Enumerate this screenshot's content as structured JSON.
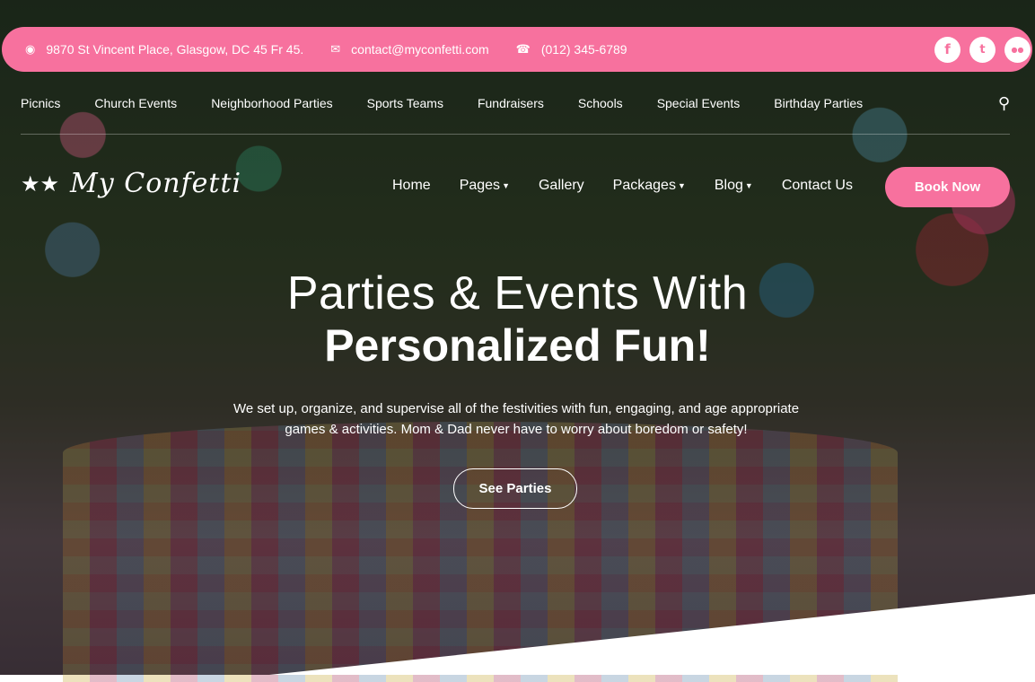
{
  "contact": {
    "address": "9870 St Vincent Place, Glasgow, DC 45 Fr 45.",
    "email": "contact@myconfetti.com",
    "phone": "(012) 345-6789",
    "address_icon": "map-marker-icon",
    "email_icon": "envelope-icon",
    "phone_icon": "phone-icon"
  },
  "social": [
    {
      "name": "facebook",
      "glyph": "f"
    },
    {
      "name": "twitter",
      "glyph": "t"
    },
    {
      "name": "flickr",
      "glyph": "●●"
    }
  ],
  "categories": [
    "Picnics",
    "Church Events",
    "Neighborhood Parties",
    "Sports Teams",
    "Fundraisers",
    "Schools",
    "Special Events",
    "Birthday Parties"
  ],
  "brand": {
    "name": "My Confetti",
    "mark_glyph": "★★"
  },
  "main_nav": [
    {
      "label": "Home",
      "dropdown": false
    },
    {
      "label": "Pages",
      "dropdown": true
    },
    {
      "label": "Gallery",
      "dropdown": false
    },
    {
      "label": "Packages",
      "dropdown": true
    },
    {
      "label": "Blog",
      "dropdown": true
    },
    {
      "label": "Contact Us",
      "dropdown": false
    }
  ],
  "book_button": "Book Now",
  "hero": {
    "headline_line1": "Parties & Events With",
    "headline_line2": "Personalized Fun!",
    "description": "We set up, organize, and supervise all of the festivities with fun, engaging, and age appropriate games & activities. Mom & Dad never have to worry about boredom or safety!",
    "cta": "See Parties"
  },
  "colors": {
    "accent": "#f7719e",
    "text": "#ffffff",
    "bottom_band": "#ffffff"
  }
}
